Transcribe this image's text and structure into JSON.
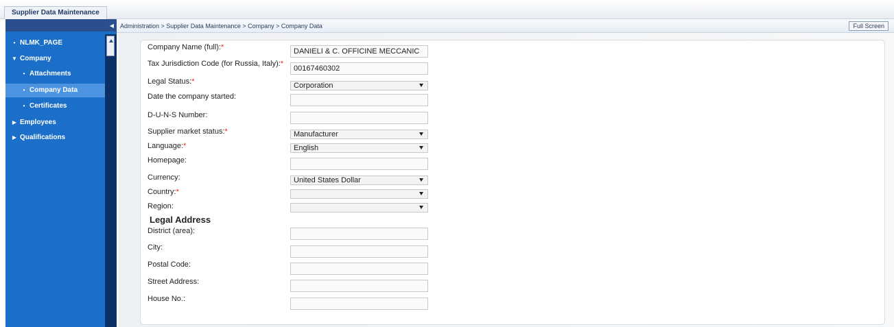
{
  "top_tab": "Supplier Data Maintenance",
  "breadcrumb": "Administration  >  Supplier Data Maintenance  >  Company  >  Company Data",
  "full_screen_label": "Full Screen",
  "sidebar": {
    "items": [
      {
        "label": "NLMK_PAGE",
        "glyph": "•",
        "level": 0
      },
      {
        "label": "Company",
        "glyph": "▼",
        "level": 0
      },
      {
        "label": "Attachments",
        "glyph": "•",
        "level": 1
      },
      {
        "label": "Company Data",
        "glyph": "•",
        "level": 1,
        "selected": true
      },
      {
        "label": "Certificates",
        "glyph": "•",
        "level": 1
      },
      {
        "label": "Employees",
        "glyph": "▶",
        "level": 0
      },
      {
        "label": "Qualifications",
        "glyph": "▶",
        "level": 0
      }
    ]
  },
  "form": {
    "company_name": {
      "label": "Company Name (full):",
      "value": "DANIELI & C. OFFICINE MECCANIC"
    },
    "tax_code": {
      "label": "Tax Jurisdiction Code (for Russia, Italy):",
      "value": "00167460302"
    },
    "legal_status": {
      "label": "Legal Status:",
      "value": "Corporation"
    },
    "date_started": {
      "label": "Date the company started:",
      "value": ""
    },
    "duns": {
      "label": "D-U-N-S Number:",
      "value": ""
    },
    "market_status": {
      "label": "Supplier market status:",
      "value": "Manufacturer"
    },
    "language": {
      "label": "Language:",
      "value": "English"
    },
    "homepage": {
      "label": "Homepage:",
      "value": ""
    },
    "currency": {
      "label": "Currency:",
      "value": "United States Dollar"
    },
    "country": {
      "label": "Country:",
      "value": ""
    },
    "region": {
      "label": "Region:",
      "value": ""
    },
    "legal_address_heading": "Legal Address",
    "district": {
      "label": "District (area):",
      "value": ""
    },
    "city": {
      "label": "City:",
      "value": ""
    },
    "postal_code": {
      "label": "Postal Code:",
      "value": ""
    },
    "street": {
      "label": "Street Address:",
      "value": ""
    },
    "house_no": {
      "label": "House No.:",
      "value": ""
    }
  },
  "required_mark": "*",
  "colors": {
    "sidebar": "#1c6fc8",
    "sidebar_selected": "#4d94e0",
    "required": "#ee2222"
  }
}
